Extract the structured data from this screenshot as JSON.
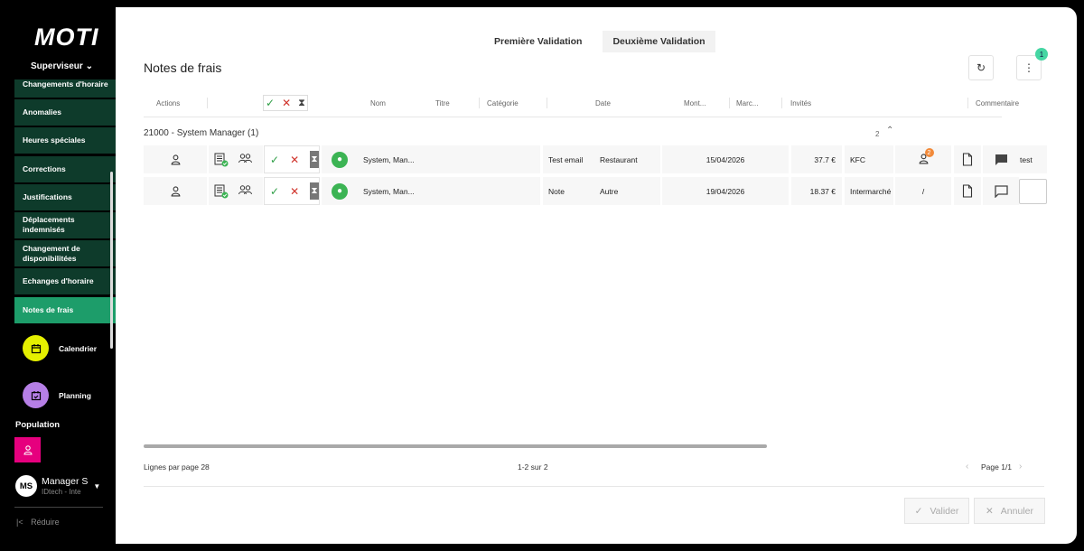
{
  "sidebar": {
    "logo": "MOTI",
    "role": "Superviseur",
    "role_caret": "⌄",
    "items": [
      {
        "label": "Changements d'horaire"
      },
      {
        "label": "Anomalies"
      },
      {
        "label": "Heures spéciales"
      },
      {
        "label": "Corrections"
      },
      {
        "label": "Justifications"
      },
      {
        "label": "Déplacements indemnisés"
      },
      {
        "label": "Changement de disponibilitées"
      },
      {
        "label": "Echanges d'horaire"
      },
      {
        "label": "Notes de frais"
      }
    ],
    "nav": [
      {
        "label": "Calendrier",
        "color": "#e5f000",
        "icon": "calendar-icon"
      },
      {
        "label": "Planning",
        "color": "#b67fe6",
        "icon": "planning-icon"
      }
    ],
    "population_label": "Population",
    "population_color": "#e6007e",
    "user": {
      "initials": "MS",
      "name": "Manager S",
      "sub": "IDtech - Inte"
    },
    "reduce_label": "Réduire"
  },
  "tabs": [
    {
      "label": "Première Validation",
      "active": false
    },
    {
      "label": "Deuxième Validation",
      "active": true
    }
  ],
  "page_title": "Notes de frais",
  "notification_count": "1",
  "columns": {
    "actions": "Actions",
    "nom": "Nom",
    "titre": "Titre",
    "categorie": "Catégorie",
    "date": "Date",
    "montant": "Mont...",
    "marchand": "Marc...",
    "invites": "Invités",
    "commentaire": "Commentaire"
  },
  "group": {
    "label": "21000 - System Manager (1)",
    "count": "2"
  },
  "rows": [
    {
      "nom": "System, Man...",
      "titre": "Test email",
      "categorie": "Restaurant",
      "date": "15/04/2026",
      "montant": "37.7 €",
      "marchand": "KFC",
      "invites_badge": "2",
      "invites_text": "",
      "commentaire": "test"
    },
    {
      "nom": "System, Man...",
      "titre": "Note",
      "categorie": "Autre",
      "date": "19/04/2026",
      "montant": "18.37 €",
      "marchand": "Intermarché",
      "invites_badge": "",
      "invites_text": "/",
      "commentaire": ""
    }
  ],
  "footer": {
    "rows_per_page": "Lignes par page 28",
    "range": "1-2 sur 2",
    "page": "Page 1/1"
  },
  "buttons": {
    "validate": "Valider",
    "cancel": "Annuler"
  },
  "colors": {
    "accent_green": "#1d9d6a",
    "menu_dark": "#0e3b2b",
    "check_green": "#2e9e46",
    "cross_red": "#d0342c"
  }
}
